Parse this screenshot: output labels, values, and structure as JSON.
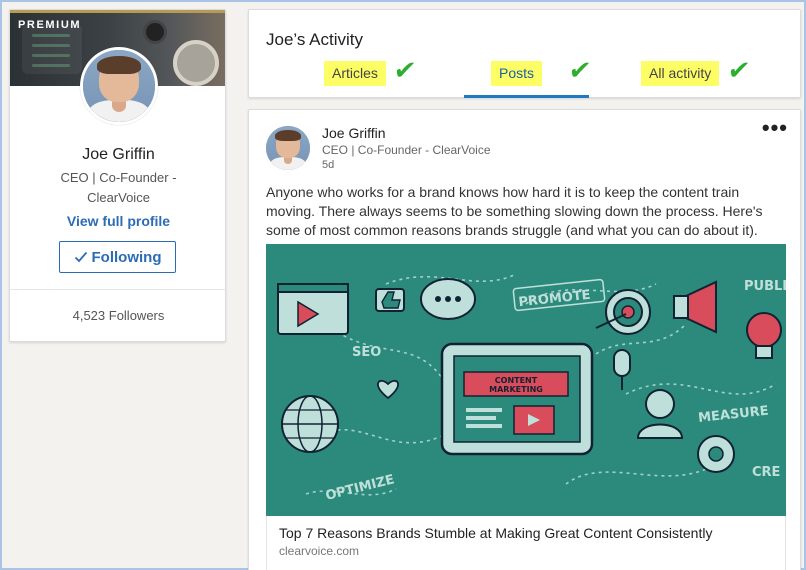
{
  "profile": {
    "badge": "PREMIUM",
    "name": "Joe Griffin",
    "title": "CEO | Co-Founder - ClearVoice",
    "view_profile": "View full profile",
    "follow_label": "Following",
    "followers": "4,523 Followers"
  },
  "activity": {
    "title": "Joe’s Activity",
    "tabs": [
      {
        "label": "Articles",
        "selected": false
      },
      {
        "label": "Posts",
        "selected": true
      },
      {
        "label": "All activity",
        "selected": false
      }
    ],
    "highlight_color": "#fdfd66",
    "check_color": "#2dae2d",
    "accent_color": "#1d79c2"
  },
  "post": {
    "author": "Joe Griffin",
    "subtitle": "CEO | Co-Founder - ClearVoice",
    "time": "5d",
    "more_label": "•••",
    "text": "Anyone who works for a brand knows how hard it is to keep the content train moving. There always seems to be something slowing down the process. Here's some of most common reasons brands struggle (and what you can do about it).",
    "image": {
      "labels": {
        "promote": "PROMOTE",
        "publish": "PUBLI",
        "seo": "SEO",
        "content_marketing_1": "CONTENT",
        "content_marketing_2": "MARKETING",
        "measure": "MEASURE",
        "optimize": "OPTIMIZE",
        "create": "CRE"
      },
      "background_color": "#2c8a7c"
    },
    "link": {
      "title": "Top 7 Reasons Brands Stumble at Making Great Content Consistently",
      "domain": "clearvoice.com"
    }
  }
}
